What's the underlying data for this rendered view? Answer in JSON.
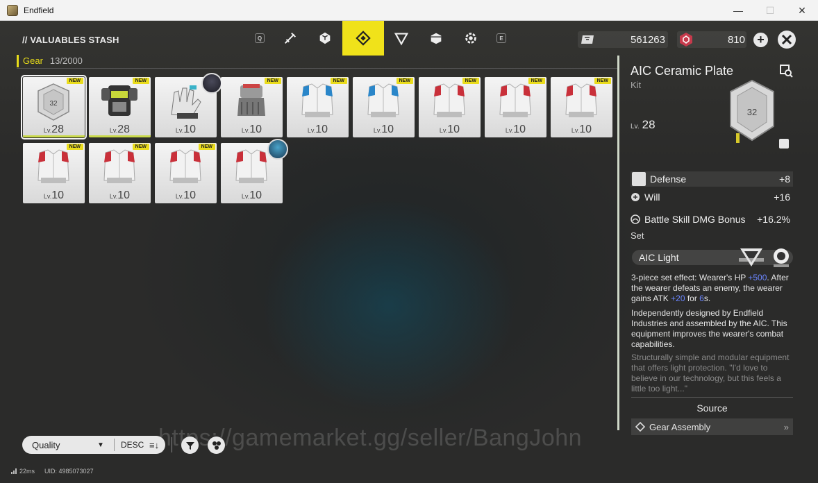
{
  "window": {
    "title": "Endfield",
    "minimize": "—",
    "maximize": "☐",
    "close": "✕"
  },
  "header": {
    "title": "// VALUABLES STASH",
    "key_left": "Q",
    "key_right": "E",
    "tabs": [
      {
        "name": "weapon-tab",
        "icon": "weapon-icon",
        "active": false
      },
      {
        "name": "gem-tab",
        "icon": "gem-icon",
        "active": false
      },
      {
        "name": "gear-tab",
        "icon": "gear-diamond-icon",
        "active": true
      },
      {
        "name": "material-tab",
        "icon": "triangle-icon",
        "active": false
      },
      {
        "name": "consumable-tab",
        "icon": "box-icon",
        "active": false
      },
      {
        "name": "special-tab",
        "icon": "flower-icon",
        "active": false
      }
    ],
    "currency1": "561263",
    "currency2": "810"
  },
  "category": {
    "label": "Gear",
    "count": "13/2000"
  },
  "items": [
    {
      "type": "plate",
      "level_prefix": "Lv.",
      "level": "28",
      "new": "NEW",
      "selected": true,
      "avatar": false
    },
    {
      "type": "armor",
      "level_prefix": "Lv.",
      "level": "28",
      "new": "NEW",
      "selected": false,
      "avatar": false
    },
    {
      "type": "glove",
      "level_prefix": "Lv.",
      "level": "10",
      "new": "",
      "selected": false,
      "avatar": true
    },
    {
      "type": "gauntlet",
      "level_prefix": "Lv.",
      "level": "10",
      "new": "NEW",
      "selected": false,
      "avatar": false
    },
    {
      "type": "vest-blue",
      "level_prefix": "Lv.",
      "level": "10",
      "new": "NEW",
      "selected": false,
      "avatar": false
    },
    {
      "type": "vest-blue",
      "level_prefix": "Lv.",
      "level": "10",
      "new": "NEW",
      "selected": false,
      "avatar": false
    },
    {
      "type": "vest-red",
      "level_prefix": "Lv.",
      "level": "10",
      "new": "NEW",
      "selected": false,
      "avatar": false
    },
    {
      "type": "vest-red",
      "level_prefix": "Lv.",
      "level": "10",
      "new": "NEW",
      "selected": false,
      "avatar": false
    },
    {
      "type": "vest-red",
      "level_prefix": "Lv.",
      "level": "10",
      "new": "NEW",
      "selected": false,
      "avatar": false
    },
    {
      "type": "vest-red",
      "level_prefix": "Lv.",
      "level": "10",
      "new": "NEW",
      "selected": false,
      "avatar": false
    },
    {
      "type": "vest-red",
      "level_prefix": "Lv.",
      "level": "10",
      "new": "NEW",
      "selected": false,
      "avatar": false
    },
    {
      "type": "vest-red",
      "level_prefix": "Lv.",
      "level": "10",
      "new": "NEW",
      "selected": false,
      "avatar": false
    },
    {
      "type": "vest-red",
      "level_prefix": "Lv.",
      "level": "10",
      "new": "",
      "selected": false,
      "avatar": true
    }
  ],
  "detail": {
    "name": "AIC Ceramic Plate",
    "category": "Kit",
    "level_prefix": "Lv.",
    "level": "28",
    "plate_number": "32",
    "stats": [
      {
        "label": "Defense",
        "value": "+8",
        "primary": true
      },
      {
        "label": "Will",
        "value": "+16",
        "primary": false
      },
      {
        "label": "Battle Skill DMG Bonus",
        "value": "+16.2%",
        "primary": false
      }
    ],
    "set_label": "Set",
    "set_name": "AIC Light",
    "set_effect": {
      "p1": "3-piece set effect: Wearer's HP ",
      "hp": "+500",
      "p2": ". After the wearer defeats an enemy, the wearer gains ATK ",
      "atk": "+20",
      "p3": " for ",
      "dur": "6",
      "p4": "s."
    },
    "description": "Independently designed by Endfield Industries and assembled by the AIC. This equipment improves the wearer's combat capabilities.",
    "flavor": "Structurally simple and modular equipment that offers light protection. \"I'd love to believe in our technology, but this feels a little too light...\"",
    "source_label": "Source",
    "source_item": "Gear Assembly"
  },
  "bottom": {
    "sort_by": "Quality",
    "order": "DESC",
    "order_icon": "≡↓",
    "watermark": "https://gamemarket.gg/seller/BangJohn",
    "ping": "22ms",
    "uid": "UID: 4985073027"
  },
  "colors": {
    "accent": "#f0e21a",
    "highlight": "#6b86ff",
    "new_badge": "#eadc1c"
  }
}
